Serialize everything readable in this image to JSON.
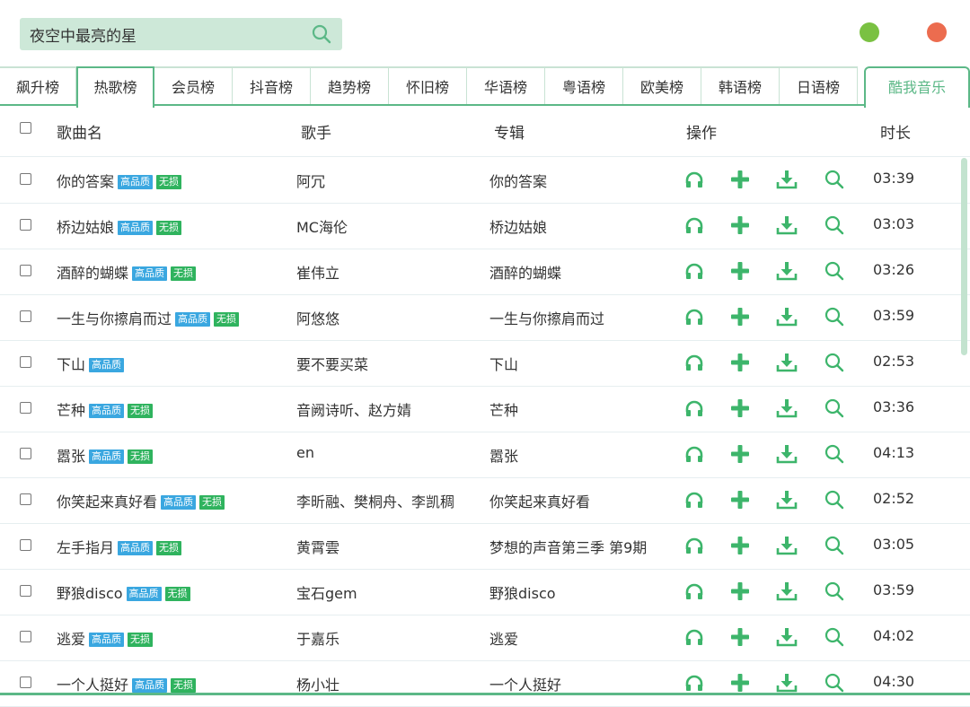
{
  "colors": {
    "accent": "#5cb887",
    "tab_border": "#c9e3d4",
    "search_bg": "#cde8d8",
    "badge_hq": "#3aa7e0",
    "badge_lossless": "#2fb35e",
    "icon_green": "#3db56b",
    "win_green": "#7ac142",
    "win_red": "#ec6c4f",
    "scrollbar": "#c3e3cf"
  },
  "search": {
    "value": "夜空中最亮的星",
    "icon": "search-icon"
  },
  "tabs": [
    "飙升榜",
    "热歌榜",
    "会员榜",
    "抖音榜",
    "趋势榜",
    "怀旧榜",
    "华语榜",
    "粤语榜",
    "欧美榜",
    "韩语榜",
    "日语榜"
  ],
  "active_tab": "热歌榜",
  "kuwo_tab": "酷我音乐",
  "table": {
    "headers": {
      "name": "歌曲名",
      "artist": "歌手",
      "album": "专辑",
      "ops": "操作",
      "duration": "时长"
    },
    "badge_labels": {
      "hq": "高品质",
      "lossless": "无损"
    },
    "rows": [
      {
        "name": "你的答案",
        "hq": true,
        "lossless": true,
        "artist": "阿冗",
        "album": "你的答案",
        "duration": "03:39"
      },
      {
        "name": "桥边姑娘",
        "hq": true,
        "lossless": true,
        "artist": "MC海伦",
        "album": "桥边姑娘",
        "duration": "03:03"
      },
      {
        "name": "酒醉的蝴蝶",
        "hq": true,
        "lossless": true,
        "artist": "崔伟立",
        "album": "酒醉的蝴蝶",
        "duration": "03:26"
      },
      {
        "name": "一生与你擦肩而过",
        "hq": true,
        "lossless": true,
        "artist": "阿悠悠",
        "album": "一生与你擦肩而过",
        "duration": "03:59"
      },
      {
        "name": "下山",
        "hq": true,
        "lossless": false,
        "artist": "要不要买菜",
        "album": "下山",
        "duration": "02:53"
      },
      {
        "name": "芒种",
        "hq": true,
        "lossless": true,
        "artist": "音阙诗听、赵方婧",
        "album": "芒种",
        "duration": "03:36"
      },
      {
        "name": "嚣张",
        "hq": true,
        "lossless": true,
        "artist": "en",
        "album": "嚣张",
        "duration": "04:13"
      },
      {
        "name": "你笑起来真好看",
        "hq": true,
        "lossless": true,
        "artist": "李昕融、樊桐舟、李凯稠",
        "album": "你笑起来真好看",
        "duration": "02:52"
      },
      {
        "name": "左手指月",
        "hq": true,
        "lossless": true,
        "artist": "黄霄雲",
        "album": "梦想的声音第三季 第9期",
        "duration": "03:05"
      },
      {
        "name": "野狼disco",
        "hq": true,
        "lossless": true,
        "artist": "宝石gem",
        "album": "野狼disco",
        "duration": "03:59"
      },
      {
        "name": "逃爱",
        "hq": true,
        "lossless": true,
        "artist": "于嘉乐",
        "album": "逃爱",
        "duration": "04:02"
      },
      {
        "name": "一个人挺好",
        "hq": true,
        "lossless": true,
        "artist": "杨小壮",
        "album": "一个人挺好",
        "duration": "04:30"
      }
    ],
    "op_icons": [
      "headphones-icon",
      "add-icon",
      "download-icon",
      "search-icon"
    ]
  }
}
